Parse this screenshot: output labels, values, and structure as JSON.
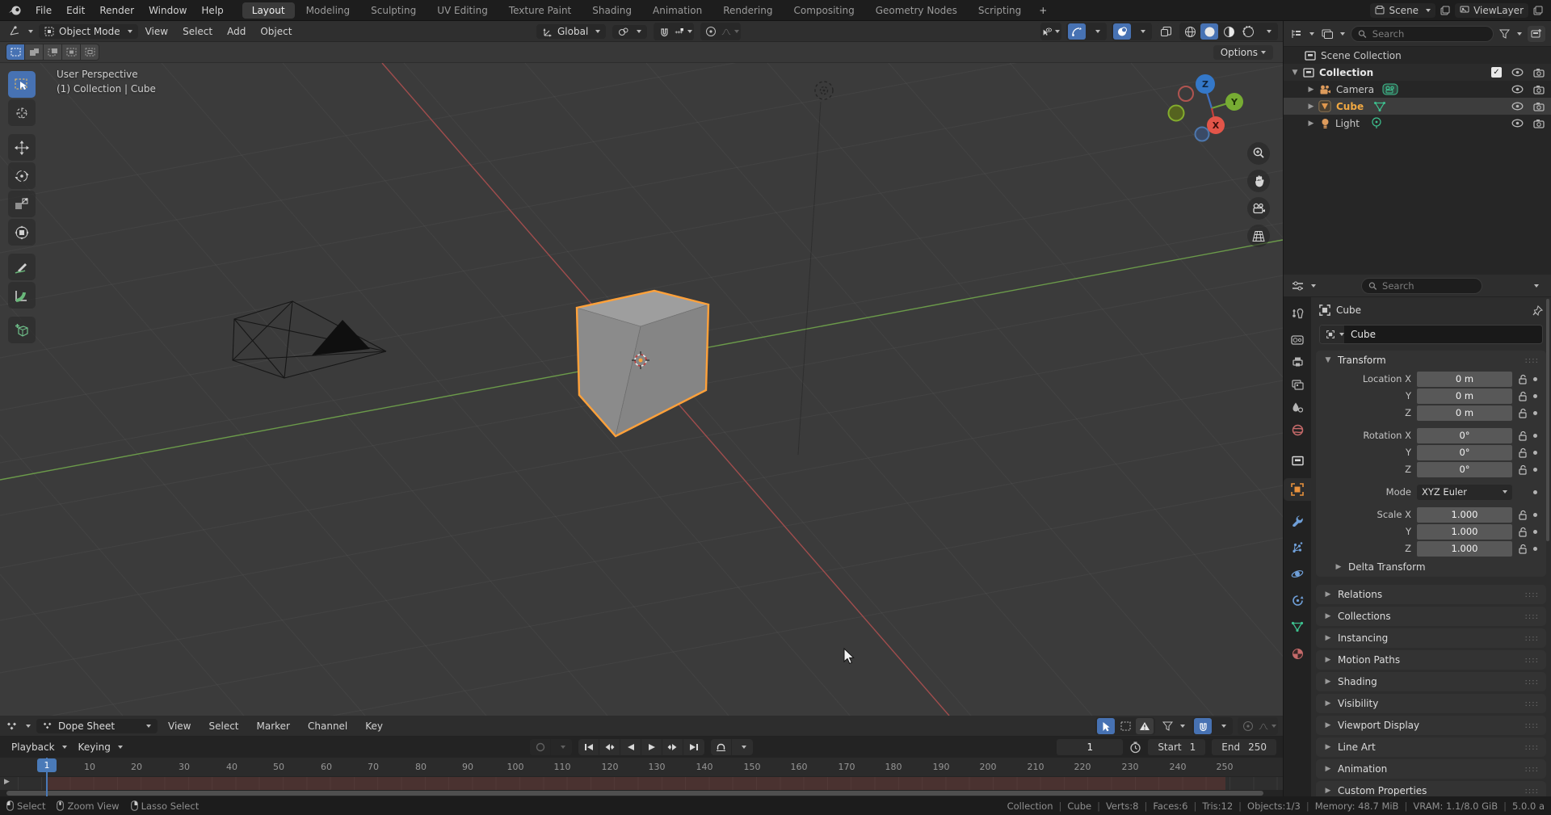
{
  "colors": {
    "accent_blue": "#4772b3",
    "selection_orange": "#ffa13a",
    "axis_red": "#a14d4d",
    "axis_green": "#6b9a4a"
  },
  "topbar": {
    "menus": [
      {
        "label": "File"
      },
      {
        "label": "Edit"
      },
      {
        "label": "Render"
      },
      {
        "label": "Window"
      },
      {
        "label": "Help"
      }
    ],
    "workspace_tabs": [
      {
        "label": "Layout"
      },
      {
        "label": "Modeling"
      },
      {
        "label": "Sculpting"
      },
      {
        "label": "UV Editing"
      },
      {
        "label": "Texture Paint"
      },
      {
        "label": "Shading"
      },
      {
        "label": "Animation"
      },
      {
        "label": "Rendering"
      },
      {
        "label": "Compositing"
      },
      {
        "label": "Geometry Nodes"
      },
      {
        "label": "Scripting"
      }
    ],
    "add_workspace": "+",
    "scene_name": "Scene",
    "viewlayer_name": "ViewLayer"
  },
  "viewport_header": {
    "mode": "Object Mode",
    "menus": [
      {
        "label": "View"
      },
      {
        "label": "Select"
      },
      {
        "label": "Add"
      },
      {
        "label": "Object"
      }
    ],
    "orientation": "Global",
    "options_label": "Options"
  },
  "viewport": {
    "view_label": "User Perspective",
    "context_label": "(1) Collection | Cube",
    "gizmo": {
      "z": "Z",
      "y": "Y",
      "x": "X"
    }
  },
  "outliner": {
    "search_placeholder": "Search",
    "rows": [
      {
        "name": "Scene Collection"
      },
      {
        "name": "Collection"
      },
      {
        "name": "Camera"
      },
      {
        "name": "Cube"
      },
      {
        "name": "Light"
      }
    ]
  },
  "properties": {
    "search_placeholder": "Search",
    "breadcrumb": "Cube",
    "object_name": "Cube",
    "transform": {
      "title": "Transform",
      "loc": [
        {
          "label": "Location X",
          "value": "0 m"
        },
        {
          "label": "Y",
          "value": "0 m"
        },
        {
          "label": "Z",
          "value": "0 m"
        }
      ],
      "rot": [
        {
          "label": "Rotation X",
          "value": "0°"
        },
        {
          "label": "Y",
          "value": "0°"
        },
        {
          "label": "Z",
          "value": "0°"
        }
      ],
      "mode": {
        "label": "Mode",
        "value": "XYZ Euler"
      },
      "scale": [
        {
          "label": "Scale X",
          "value": "1.000"
        },
        {
          "label": "Y",
          "value": "1.000"
        },
        {
          "label": "Z",
          "value": "1.000"
        }
      ],
      "delta_label": "Delta Transform"
    },
    "panels": [
      {
        "label": "Relations"
      },
      {
        "label": "Collections"
      },
      {
        "label": "Instancing"
      },
      {
        "label": "Motion Paths"
      },
      {
        "label": "Shading"
      },
      {
        "label": "Visibility"
      },
      {
        "label": "Viewport Display"
      },
      {
        "label": "Line Art"
      },
      {
        "label": "Animation"
      },
      {
        "label": "Custom Properties"
      }
    ]
  },
  "timeline": {
    "editor_name": "Dope Sheet",
    "menus": [
      {
        "label": "View"
      },
      {
        "label": "Select"
      },
      {
        "label": "Marker"
      },
      {
        "label": "Channel"
      },
      {
        "label": "Key"
      }
    ],
    "playback_label": "Playback",
    "keying_label": "Keying",
    "current_frame": "1",
    "playhead_label": "1",
    "start_label": "Start",
    "start_value": "1",
    "end_label": "End",
    "end_value": "250",
    "ruler": [
      "10",
      "20",
      "30",
      "40",
      "50",
      "60",
      "70",
      "80",
      "90",
      "100",
      "110",
      "120",
      "130",
      "140",
      "150",
      "160",
      "170",
      "180",
      "190",
      "200",
      "210",
      "220",
      "230",
      "240",
      "250"
    ]
  },
  "statusbar": {
    "hints": [
      {
        "label": "Select"
      },
      {
        "label": "Zoom View"
      },
      {
        "label": "Lasso Select"
      }
    ],
    "info": [
      "Collection",
      "Cube",
      "Verts:8",
      "Faces:6",
      "Tris:12",
      "Objects:1/3",
      "Memory: 48.7 MiB",
      "VRAM: 1.1/8.0 GiB",
      "5.0.0 a"
    ]
  }
}
